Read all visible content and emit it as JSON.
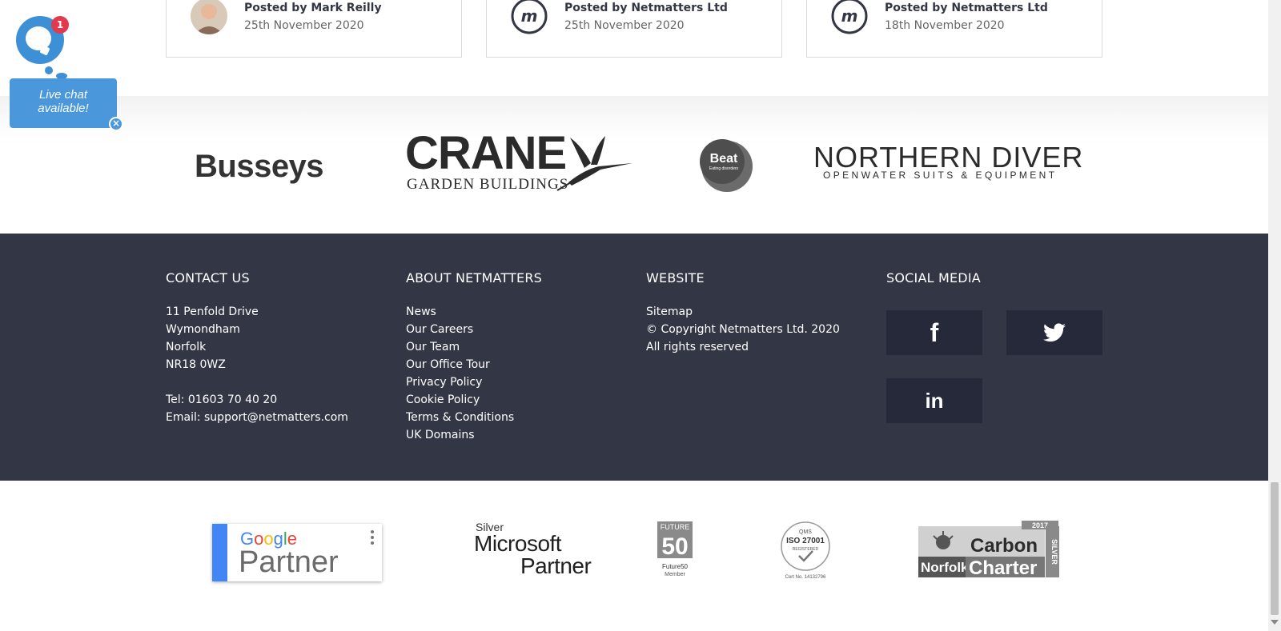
{
  "posts": [
    {
      "author": "Posted by Mark Reilly",
      "date": "25th November 2020",
      "avatar": "person-photo"
    },
    {
      "author": "Posted by Netmatters Ltd",
      "date": "25th November 2020",
      "avatar": "netmatters-logo"
    },
    {
      "author": "Posted by Netmatters Ltd",
      "date": "18th November 2020",
      "avatar": "netmatters-logo"
    }
  ],
  "clients": {
    "busseys": "Busseys",
    "crane_word": "CRANE",
    "crane_sub": "GARDEN BUILDINGS",
    "beat_word": "Beat",
    "beat_sub": "Eating disorders",
    "northern_word": "NORTHERN DIVER",
    "northern_sub": "OPENWATER SUITS & EQUIPMENT"
  },
  "footer": {
    "contact": {
      "heading": "CONTACT US",
      "address": [
        "11 Penfold Drive",
        "Wymondham",
        "Norfolk",
        "NR18 0WZ"
      ],
      "tel": "Tel: 01603 70 40 20",
      "email": "Email: support@netmatters.com"
    },
    "about": {
      "heading": "ABOUT NETMATTERS",
      "links": [
        "News",
        "Our Careers",
        "Our Team",
        "Our Office Tour",
        "Privacy Policy",
        "Cookie Policy",
        "Terms & Conditions",
        "UK Domains"
      ]
    },
    "website": {
      "heading": "WEBSITE",
      "sitemap": "Sitemap",
      "copyright": "© Copyright Netmatters Ltd. 2020",
      "rights": "All rights reserved"
    },
    "social": {
      "heading": "SOCIAL MEDIA",
      "buttons": [
        {
          "name": "facebook",
          "glyph": "f"
        },
        {
          "name": "twitter",
          "icon": "twitter-bird-icon"
        },
        {
          "name": "linkedin",
          "glyph": "in"
        }
      ]
    }
  },
  "accreditations": {
    "google_word": "Google",
    "google_partner": "Partner",
    "ms_silver": "Silver",
    "ms_microsoft": "Microsoft",
    "ms_partner": "Partner",
    "future_word": "FUTURE",
    "future_num": "50",
    "future_member_1": "Future50",
    "future_member_2": "Member",
    "iso_top": "QMS",
    "iso_main": "ISO 27001",
    "iso_reg": "REGISTERED",
    "iso_cert": "Cert No. 14132796",
    "carbon_year": "2017",
    "carbon_carbon": "Carbon",
    "carbon_norfolk": "Norfolk",
    "carbon_charter": "Charter",
    "carbon_silver": "SILVER"
  },
  "chat": {
    "badge": "1",
    "text_line1": "Live chat",
    "text_line2": "available!",
    "close": "×"
  },
  "colors": {
    "footer_bg": "#333645",
    "social_bg": "#26293a",
    "chat_blue": "#4a98db",
    "badge_red": "#e03a4e"
  }
}
